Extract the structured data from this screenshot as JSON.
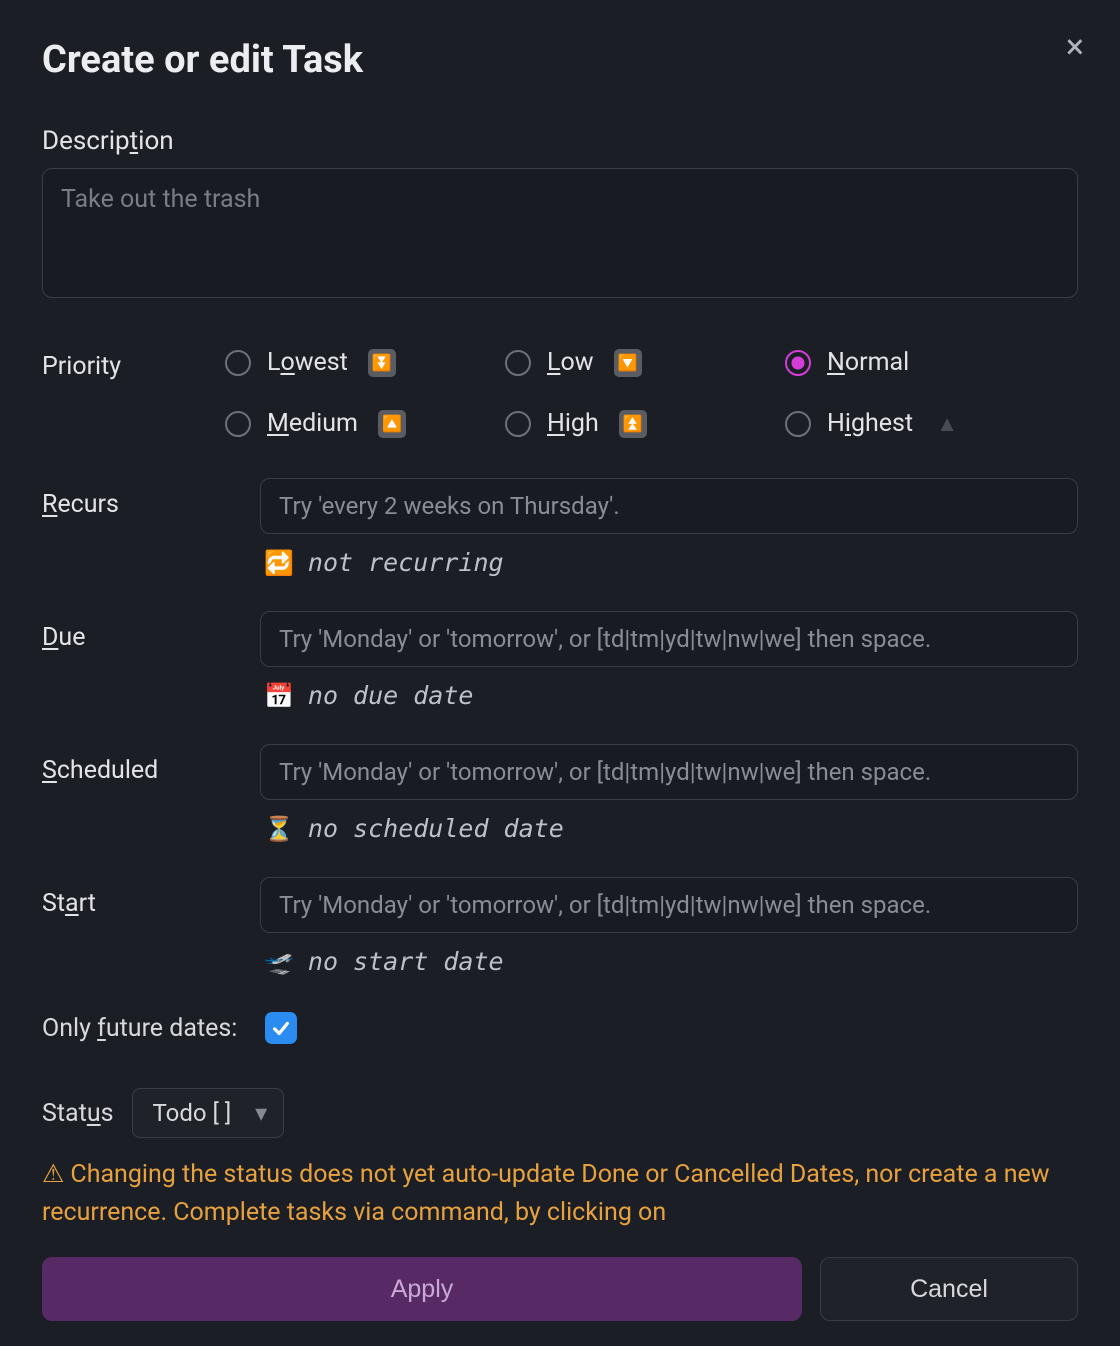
{
  "title": "Create or edit Task",
  "close_label": "×",
  "description": {
    "label_pre": "Descrip",
    "label_ul": "t",
    "label_post": "ion",
    "placeholder": "Take out the trash",
    "value": ""
  },
  "priority": {
    "label": "Priority",
    "options": [
      {
        "pre": "L",
        "ul": "o",
        "post": "west",
        "icon": "⏬",
        "selected": false,
        "name": "priority-lowest"
      },
      {
        "pre": "",
        "ul": "L",
        "post": "ow",
        "icon": "🔽",
        "selected": false,
        "name": "priority-low"
      },
      {
        "pre": "",
        "ul": "N",
        "post": "ormal",
        "icon": "",
        "selected": true,
        "name": "priority-normal"
      },
      {
        "pre": "",
        "ul": "M",
        "post": "edium",
        "icon": "🔼",
        "selected": false,
        "name": "priority-medium"
      },
      {
        "pre": "",
        "ul": "H",
        "post": "igh",
        "icon": "⏫",
        "selected": false,
        "name": "priority-high"
      },
      {
        "pre": "H",
        "ul": "i",
        "post": "ghest",
        "icon": "▲",
        "selected": false,
        "name": "priority-highest",
        "light": true
      }
    ]
  },
  "fields": {
    "recurs": {
      "label_ul": "R",
      "label_rest": "ecurs",
      "placeholder": "Try 'every 2 weeks on Thursday'.",
      "hint_icon": "🔁",
      "hint_text": "not recurring"
    },
    "due": {
      "label_ul": "D",
      "label_rest": "ue",
      "placeholder": "Try 'Monday' or 'tomorrow', or [td|tm|yd|tw|nw|we] then space.",
      "hint_icon": "📅",
      "hint_text": "no due date"
    },
    "scheduled": {
      "label_ul": "S",
      "label_rest": "cheduled",
      "placeholder": "Try 'Monday' or 'tomorrow', or [td|tm|yd|tw|nw|we] then space.",
      "hint_icon": "⏳",
      "hint_text": "no scheduled date"
    },
    "start": {
      "label_pre": "St",
      "label_ul": "a",
      "label_post": "rt",
      "placeholder": "Try 'Monday' or 'tomorrow', or [td|tm|yd|tw|nw|we] then space.",
      "hint_icon": "🛫",
      "hint_text": "no start date"
    }
  },
  "future_dates": {
    "label_pre": "Only ",
    "label_ul": "f",
    "label_post": "uture dates:",
    "checked": true
  },
  "status": {
    "label_pre": "Stat",
    "label_ul": "u",
    "label_post": "s",
    "selected": "Todo [ ]"
  },
  "warning": {
    "icon": "⚠",
    "text": "Changing the status does not yet auto-update Done or Cancelled Dates, nor create a new recurrence. Complete tasks via command, by clicking on"
  },
  "buttons": {
    "apply": "Apply",
    "cancel": "Cancel"
  }
}
